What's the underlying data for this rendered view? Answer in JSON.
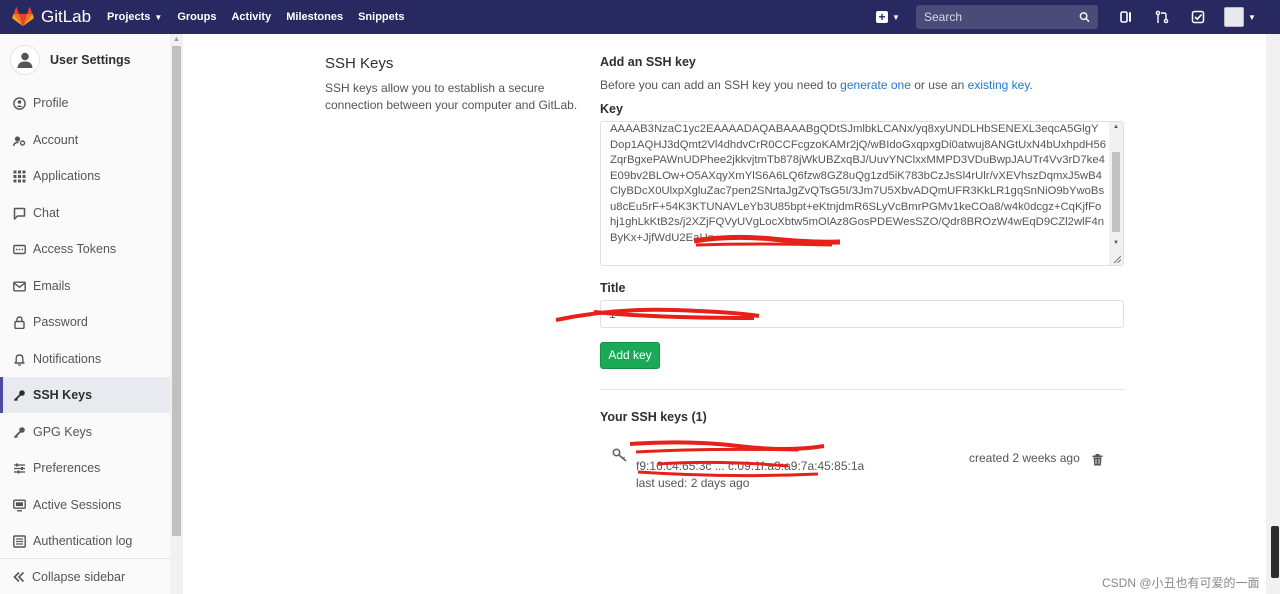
{
  "navbar": {
    "brand": "GitLab",
    "links": [
      {
        "label": "Projects",
        "caret": true
      },
      {
        "label": "Groups",
        "caret": false
      },
      {
        "label": "Activity",
        "caret": false
      },
      {
        "label": "Milestones",
        "caret": false
      },
      {
        "label": "Snippets",
        "caret": false
      }
    ],
    "search_placeholder": "Search",
    "colors": {
      "bg": "#292961",
      "search_bg": "#4b4b7a"
    }
  },
  "sidebar": {
    "title": "User Settings",
    "items": [
      {
        "label": "Profile",
        "icon": "profile-icon"
      },
      {
        "label": "Account",
        "icon": "account-icon"
      },
      {
        "label": "Applications",
        "icon": "applications-icon"
      },
      {
        "label": "Chat",
        "icon": "chat-icon"
      },
      {
        "label": "Access Tokens",
        "icon": "access-tokens-icon"
      },
      {
        "label": "Emails",
        "icon": "emails-icon"
      },
      {
        "label": "Password",
        "icon": "lock-icon"
      },
      {
        "label": "Notifications",
        "icon": "bell-icon"
      },
      {
        "label": "SSH Keys",
        "icon": "key-icon",
        "active": true
      },
      {
        "label": "GPG Keys",
        "icon": "gpg-key-icon"
      },
      {
        "label": "Preferences",
        "icon": "preferences-icon"
      },
      {
        "label": "Active Sessions",
        "icon": "monitor-icon"
      },
      {
        "label": "Authentication log",
        "icon": "log-icon"
      }
    ],
    "collapse_label": "Collapse sidebar"
  },
  "main": {
    "section_title": "SSH Keys",
    "section_desc": "SSH keys allow you to establish a secure connection between your computer and GitLab.",
    "add_title": "Add an SSH key",
    "add_desc_prefix": "Before you can add an SSH key you need to",
    "add_desc_link1": "generate one",
    "add_desc_mid": "or use an",
    "add_desc_link2": "existing key",
    "add_desc_suffix": ".",
    "key_label": "Key",
    "key_value": "AAAAB3NzaC1yc2EAAAADAQABAAABgQDtSJmlbkLCANx/yq8xyUNDLHbSENEXL3eqcA5GlgYDop1AQHJ3dQmt2Vl4dhdvCrR0CCFcgzoKAMr2jQ/wBIdoGxqpxgDi0atwuj8ANGtUxN4bUxhpdH56ZqrBgxePAWnUDPhee2jkkvjtmTb878jWkUBZxqBJ/UuvYNClxxMMPD3VDuBwpJAUTr4Vv3rD7ke4E09bv2BLOw+O5AXqyXmYlS6A6LQ6fzw8GZ8uQg1zd5iK783bCzJsSl4rUlr/vXEVhszDqmxJ5wB4ClyBDcX0UlxpXgluZac7pen2SNrtaJgZvQTsG5I/3Jm7U5XbvADQmUFR3KkLR1gqSnNiO9bYwoBsu8cEu5rF+54K3KTUNAVLeYb3U85bpt+eKtnjdmR6SLyVcBmrPGMv1keCOa8/w4k0dcgz+CqKjfFohj1ghLkKtB2s/j2XZjFQVyUVgLocXbtw5mOlAz8GosPDEWesSZO/Qdr8BROzW4wEqD9CZl2wlF4nByKx+JjfWdU2EaU=",
    "title_label": "Title",
    "title_value": "1",
    "add_button": "Add key",
    "your_keys_label": "Your SSH keys (1)",
    "key_entry": {
      "line2_visible": "f9:16:c4:65:3c ... c:09:1f:a3:a9:7a:45:85:1a",
      "last_used": "last used: 2 days ago",
      "created": "created 2 weeks ago"
    }
  },
  "watermark": "CSDN @小丑也有可爱的一面"
}
